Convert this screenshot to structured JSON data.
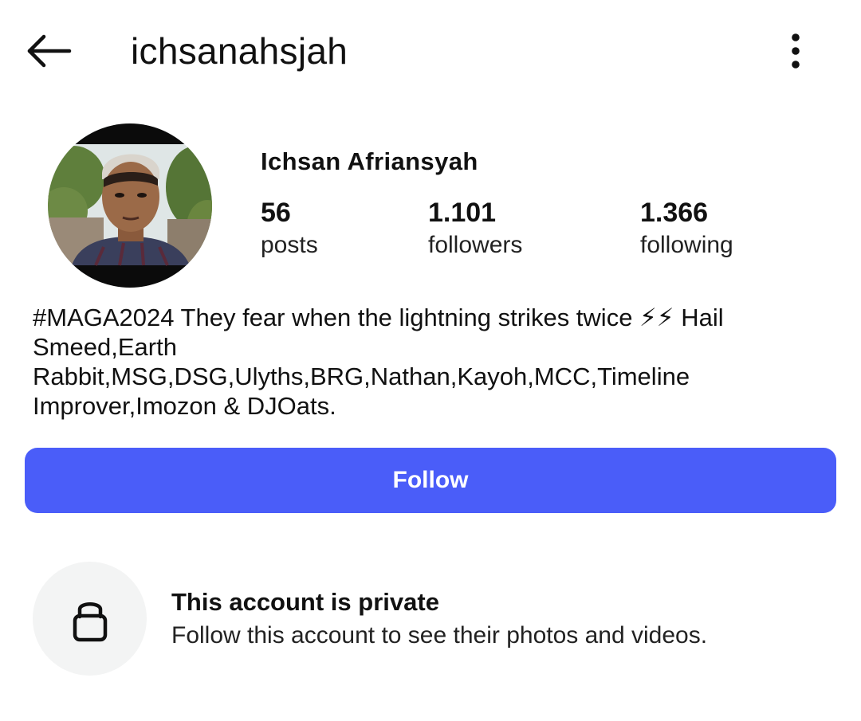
{
  "header": {
    "username": "ichsanahsjah",
    "back_icon": "arrow-left-icon",
    "menu_icon": "more-vertical-icon"
  },
  "profile": {
    "display_name": "Ichsan Afriansyah",
    "stats": [
      {
        "value": "56",
        "label": "posts"
      },
      {
        "value": "1.101",
        "label": "followers"
      },
      {
        "value": "1.366",
        "label": "following"
      }
    ],
    "bio": "#MAGA2024 They fear when the lightning strikes twice ⚡⚡ Hail Smeed,Earth\nRabbit,MSG,DSG,Ulyths,BRG,Nathan,Kayoh,MCC,Timeline Improver,Imozon & DJOats."
  },
  "actions": {
    "follow_label": "Follow"
  },
  "private_notice": {
    "title": "This account is private",
    "subtitle": "Follow this account to see their photos and videos.",
    "icon": "lock-icon"
  },
  "colors": {
    "accent": "#4a5df9",
    "lock_bg": "#f3f4f4"
  }
}
